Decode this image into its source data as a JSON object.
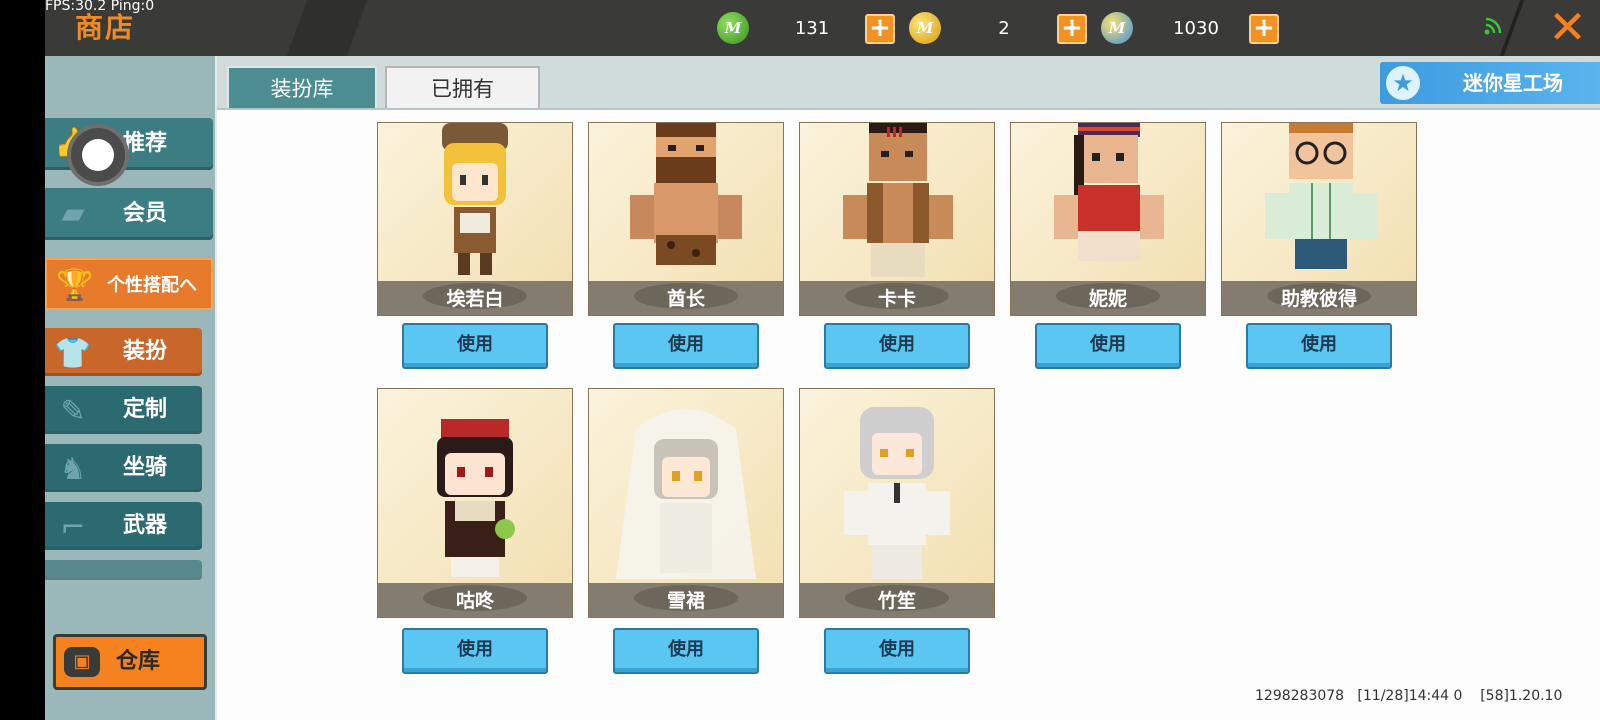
{
  "status": {
    "fps": "FPS:30.2  Ping:0"
  },
  "header": {
    "title": "商店",
    "currencies": [
      {
        "icon": "green-gem-icon",
        "amount": "131",
        "color": "#4caf3a"
      },
      {
        "icon": "gold-coin-icon",
        "amount": "2",
        "color": "#e8b21c"
      },
      {
        "icon": "mini-coin-icon",
        "amount": "1030",
        "color": "#3b8de0"
      }
    ]
  },
  "sidebar": {
    "items": [
      {
        "label": "推荐",
        "icon": "thumbs-up-icon"
      },
      {
        "label": "会员",
        "icon": "vip-icon"
      },
      {
        "label": "个性搭配へ",
        "icon": "trophy-icon"
      },
      {
        "label": "装扮",
        "icon": "shirt-icon"
      },
      {
        "label": "定制",
        "icon": "pencil-icon"
      },
      {
        "label": "坐骑",
        "icon": "mount-icon"
      },
      {
        "label": "武器",
        "icon": "gun-icon"
      }
    ],
    "warehouse": "仓库"
  },
  "tabs": {
    "active": "装扮库",
    "inactive": "已拥有"
  },
  "workshop": {
    "label": "迷你星工场"
  },
  "cards": [
    {
      "name": "埃若白",
      "button": "使用"
    },
    {
      "name": "酋长",
      "button": "使用"
    },
    {
      "name": "卡卡",
      "button": "使用"
    },
    {
      "name": "妮妮",
      "button": "使用"
    },
    {
      "name": "助教彼得",
      "button": "使用"
    },
    {
      "name": "咕咚",
      "button": "使用"
    },
    {
      "name": "雪裙",
      "button": "使用"
    },
    {
      "name": "竹笙",
      "button": "使用"
    }
  ],
  "footer": {
    "info": "1298283078   [11/28]14:44 0    [58]1.20.10"
  },
  "colors": {
    "accent": "#f28a22",
    "sidebar": "#3c7d83",
    "use_button": "#5bc6f2"
  }
}
